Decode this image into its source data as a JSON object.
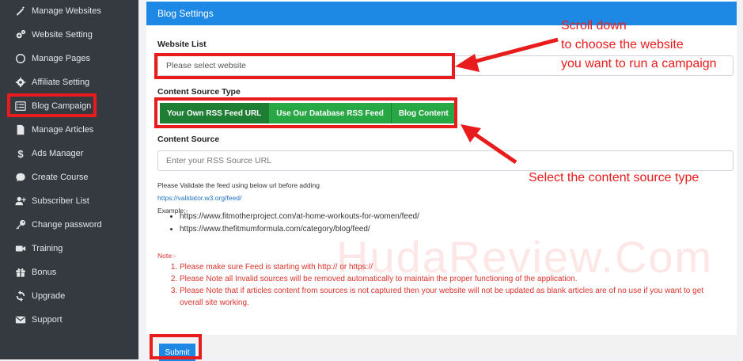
{
  "sidebar": {
    "items": [
      {
        "label": "Manage Websites",
        "icon": "magic-wand-icon"
      },
      {
        "label": "Website Setting",
        "icon": "gears-icon"
      },
      {
        "label": "Manage Pages",
        "icon": "circle-icon"
      },
      {
        "label": "Affiliate Setting",
        "icon": "gear-icon"
      },
      {
        "label": "Blog Campaign",
        "icon": "list-icon"
      },
      {
        "label": "Manage Articles",
        "icon": "file-icon"
      },
      {
        "label": "Ads Manager",
        "icon": "dollar-icon"
      },
      {
        "label": "Create Course",
        "icon": "chat-icon"
      },
      {
        "label": "Subscriber List",
        "icon": "user-plus-icon"
      },
      {
        "label": "Change password",
        "icon": "key-icon"
      },
      {
        "label": "Training",
        "icon": "video-icon"
      },
      {
        "label": "Bonus",
        "icon": "gift-icon"
      },
      {
        "label": "Upgrade",
        "icon": "sync-icon"
      },
      {
        "label": "Support",
        "icon": "envelope-icon"
      }
    ]
  },
  "card": {
    "title": "Blog Settings",
    "website_list_label": "Website List",
    "website_placeholder": "Please select website",
    "content_type_label": "Content Source Type",
    "source_buttons": [
      "Your Own RSS Feed URL",
      "Use Our Database RSS Feed",
      "Blog Content"
    ],
    "content_source_label": "Content Source",
    "content_source_placeholder": "Enter your RSS Source URL",
    "validate_text": "Please Validate the feed using below url before adding",
    "validate_link": "https://validator.w3.org/feed/",
    "example_label": "Example:-",
    "examples": [
      "https://www.fitmotherproject.com/at-home-workouts-for-women/feed/",
      "https://www.thefitmumformula.com/category/blog/feed/"
    ],
    "note_label": "Note:-",
    "notes": [
      "Please make sure Feed is starting with http:// or https://",
      "Please Note all Invalid sources will be removed automatically to maintain the proper functioning of the application.",
      "Please Note that if articles content from sources is not captured then your website will not be updated as blank articles are of no use if you want to get overall site working."
    ],
    "submit_label": "Submit"
  },
  "annotations": {
    "scroll_lines": [
      "Scroll down",
      "to choose the website",
      "you want to run a campaign"
    ],
    "select_text": "Select the content source type",
    "color": "#e81c1c"
  },
  "watermark": "HudaReview.Com",
  "colors": {
    "sidebar": "#343a40",
    "header": "#1e88e5",
    "green": "#28a745",
    "note_red": "#d9332b"
  }
}
